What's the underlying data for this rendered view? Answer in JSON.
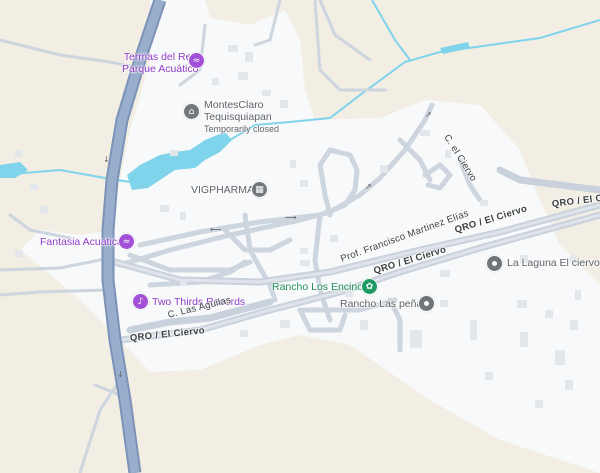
{
  "map": {
    "colors": {
      "land": "#f2eee4",
      "urban": "#f8f9fa",
      "road": "#cdd5de",
      "highway": "#8fa4c3",
      "water": "#7fd3ea",
      "building": "#e6e8ec"
    },
    "places": [
      {
        "name_line1": "Termas del Rey",
        "name_line2": "Parque Acuático",
        "icon": "pool-icon",
        "category": "purple"
      },
      {
        "name_line1": "MontesClaro",
        "name_line2": "Tequisquiapan",
        "status": "Temporarily closed",
        "icon": "hotel-icon",
        "category": "gray"
      },
      {
        "name_line1": "VIGPHARMA",
        "icon": "bank-icon",
        "category": "gray"
      },
      {
        "name_line1": "Fantasia Acuatica",
        "icon": "pool-icon",
        "category": "purple"
      },
      {
        "name_line1": "Two Thirds Records",
        "icon": "music-icon",
        "category": "purple"
      },
      {
        "name_line1": "Rancho Los Encinos",
        "icon": "park-icon",
        "category": "green"
      },
      {
        "name_line1": "Rancho Las peñas",
        "icon": "pin-icon",
        "category": "gray"
      },
      {
        "name_line1": "La Laguna El ciervo",
        "icon": "pin-icon",
        "category": "gray"
      }
    ],
    "roads": [
      {
        "name": "QRO / El Ciervo"
      },
      {
        "name": "QRO / El Ciervo"
      },
      {
        "name": "QRO / El Ciervo"
      },
      {
        "name": "QRO / El Ciervo"
      },
      {
        "name": "Prof. Francisco Martinez Elías"
      },
      {
        "name": "C. el Ciervo"
      },
      {
        "name": "C. Las Aguilas"
      }
    ]
  }
}
